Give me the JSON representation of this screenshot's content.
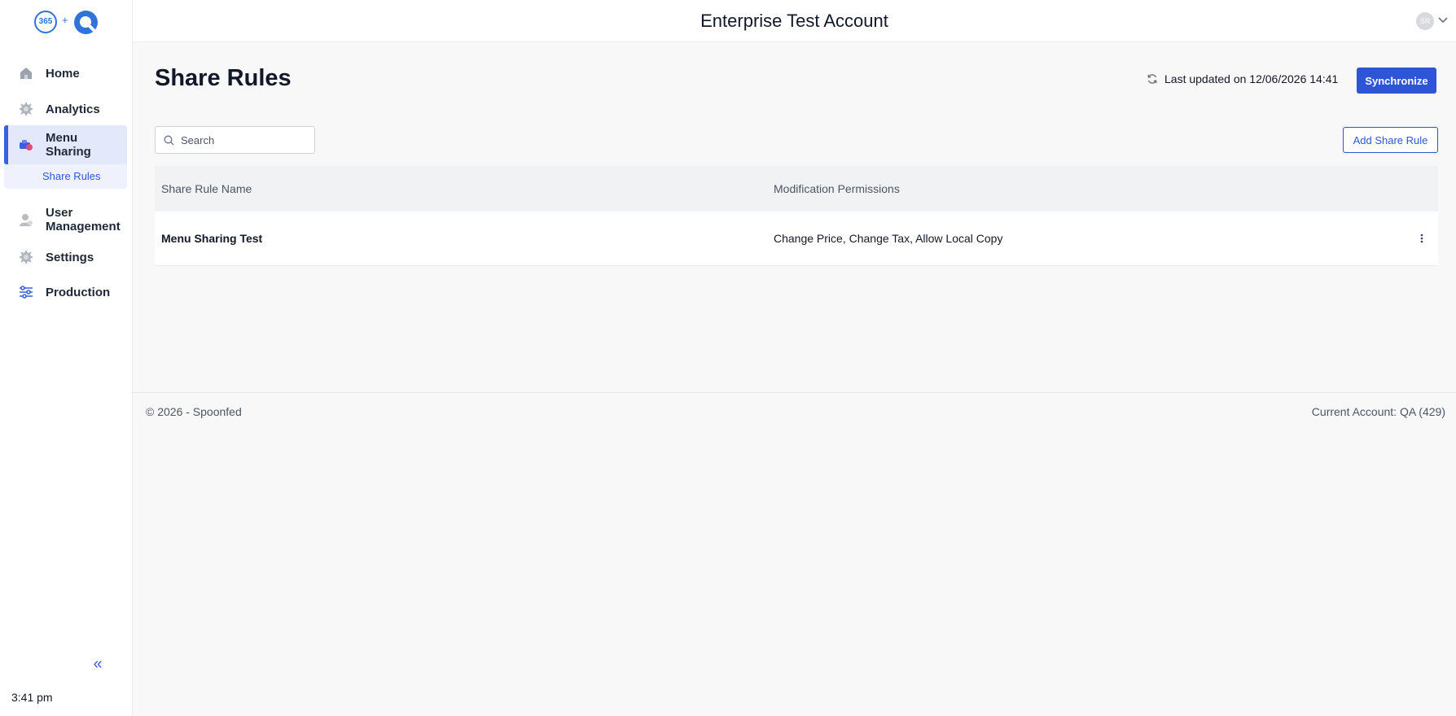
{
  "header": {
    "logo_365": "365",
    "logo_plus": "+",
    "account_title": "Enterprise Test Account",
    "avatar_initials": "SR"
  },
  "sidebar": {
    "items": [
      {
        "label": "Home",
        "icon": "home-icon"
      },
      {
        "label": "Analytics",
        "icon": "analytics-gear-icon"
      },
      {
        "label": "Menu Sharing",
        "icon": "menu-sharing-icon",
        "active": true
      },
      {
        "label": "User Management",
        "icon": "user-icon"
      },
      {
        "label": "Settings",
        "icon": "gear-icon"
      },
      {
        "label": "Production",
        "icon": "sliders-icon"
      }
    ],
    "sub_items": [
      {
        "label": "Share Rules",
        "active": true
      }
    ],
    "collapse_icon": "«",
    "clock": "3:41 pm"
  },
  "main": {
    "page_title": "Share Rules",
    "last_updated": "Last updated on 12/06/2026 14:41",
    "sync_label": "Synchronize",
    "search_placeholder": "Search",
    "add_label": "Add Share Rule",
    "table": {
      "columns": [
        "Share Rule Name",
        "Modification Permissions"
      ],
      "rows": [
        {
          "name": "Menu Sharing Test",
          "permissions": "Change Price, Change Tax, Allow Local Copy"
        }
      ]
    }
  },
  "footer": {
    "copyright": "© 2026 - Spoonfed",
    "current_account": "Current Account: QA (429)"
  },
  "colors": {
    "accent": "#2d55d6",
    "active_nav_bg": "#e3e8fa",
    "brand": "#2f74d8"
  }
}
